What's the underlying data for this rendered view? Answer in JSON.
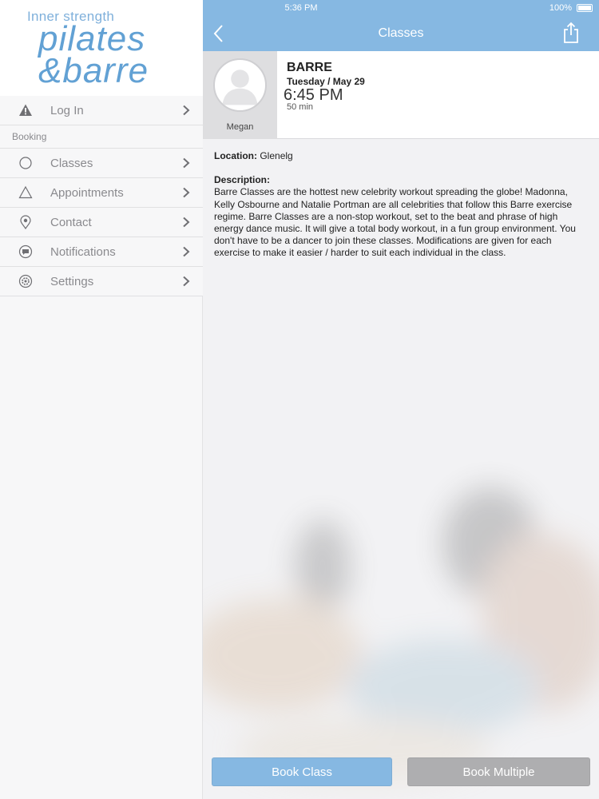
{
  "brand": {
    "tagline": "Inner strength",
    "logo_line1": "pilates",
    "logo_line2": "&barre",
    "color": "#62a1d4"
  },
  "sidebar": {
    "items": [
      {
        "label": "Log In",
        "icon": "warning-icon"
      },
      {
        "label": "Booking",
        "section": true
      },
      {
        "label": "Classes",
        "icon": "circle-icon"
      },
      {
        "label": "Appointments",
        "icon": "triangle-icon"
      },
      {
        "label": "Contact",
        "icon": "location-pin-icon"
      },
      {
        "label": "Notifications",
        "icon": "chat-bubble-icon"
      },
      {
        "label": "Settings",
        "icon": "gear-icon"
      }
    ]
  },
  "status_bar": {
    "time": "5:36 PM",
    "battery": "100%"
  },
  "nav": {
    "title": "Classes"
  },
  "class": {
    "instructor": "Megan",
    "name": "BARRE",
    "date": "Tuesday / May 29",
    "time": "6:45 PM",
    "duration": "50 min",
    "location_label": "Location:",
    "location": "Glenelg",
    "description_label": "Description:",
    "description": "Barre Classes are the hottest new celebrity workout spreading the globe! Madonna, Kelly Osbourne and Natalie Portman are all celebrities that follow this Barre exercise regime. Barre Classes are a non-stop workout, set to the beat and phrase of high energy dance music. It will give a total body workout, in a fun group environment.  You don't have to be a dancer to join these classes. Modifications are given for each exercise to make it easier / harder to suit each individual in the class."
  },
  "buttons": {
    "book": "Book Class",
    "book_multiple": "Book Multiple"
  },
  "colors": {
    "accent": "#86b8e2",
    "secondary_button": "#aeaeb0"
  }
}
